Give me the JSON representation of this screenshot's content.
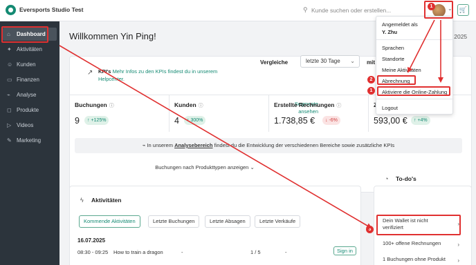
{
  "header": {
    "studio_name": "Eversports Studio Test",
    "search_placeholder": "Kunde suchen oder erstellen..."
  },
  "sidebar": {
    "items": [
      {
        "label": "Dashboard",
        "icon": "home-icon"
      },
      {
        "label": "Aktivitäten",
        "icon": "sparkle-icon"
      },
      {
        "label": "Kunden",
        "icon": "user-icon"
      },
      {
        "label": "Finanzen",
        "icon": "wallet-icon"
      },
      {
        "label": "Analyse",
        "icon": "chart-icon"
      },
      {
        "label": "Produkte",
        "icon": "box-icon"
      },
      {
        "label": "Videos",
        "icon": "play-icon"
      },
      {
        "label": "Marketing",
        "icon": "megaphone-icon"
      }
    ]
  },
  "main": {
    "title": "Willkommen Yin Ping!",
    "date_fragment": "l 2025",
    "kpi_heading": "KPI's",
    "kpi_link_text": "Mehr Infos zu den KPIs findest du in unserem Helpcenter.",
    "compare_label": "Vergleiche",
    "compare_value": "letzte 30 Tage",
    "compare_mit": "mit",
    "stats": [
      {
        "label": "Buchungen",
        "value": "9",
        "change": "+125%",
        "trend": "up"
      },
      {
        "label": "Kunden",
        "value": "4",
        "change": "300%",
        "trend": "up"
      },
      {
        "label": "Erstellte Rechnungen",
        "value": "1.738,85 €",
        "change": "-6%",
        "trend": "down"
      },
      {
        "label": "Z",
        "value": "593,00 €",
        "change": "+4%",
        "trend": "up"
      }
    ],
    "segments_link": "Segmente ansehen",
    "hint_prefix": "In unserem",
    "hint_link": "Analysebereich",
    "hint_suffix": "findest du die Entwicklung der verschiedenen Bereiche sowie zusätzliche KPIs",
    "product_types_link": "Buchungen nach Produkttypen anzeigen"
  },
  "activities": {
    "title": "Aktivitäten",
    "tabs": [
      "Kommende Aktivitäten",
      "Letzte Buchungen",
      "Letzte Absagen",
      "Letzte Verkäufe"
    ],
    "date": "16.07.2025",
    "row": {
      "time": "08:30 - 09:25",
      "name": "How to train a dragon",
      "dash1": "-",
      "count": "1 / 5",
      "dash2": "-",
      "action": "Sign in"
    }
  },
  "todos": {
    "title": "To-do's",
    "items": [
      "Dein Wallet ist nicht verifiziert",
      "100+ offene Rechnungen",
      "1 Buchungen ohne Produkt"
    ]
  },
  "user_menu": {
    "logged_in_as_label": "Angemeldet als",
    "user_name": "Y. Zhu",
    "items": [
      "Sprachen",
      "Standorte",
      "Meine Aktivitäten",
      "Abrechnung",
      "Aktiviere die Online-Zahlung",
      "Logout"
    ]
  },
  "annotations": {
    "badge_avatar": "1",
    "badge_abrechnung": "2",
    "badge_online_payment": "1",
    "badge_wallet": "3",
    "color": "#e03030"
  }
}
